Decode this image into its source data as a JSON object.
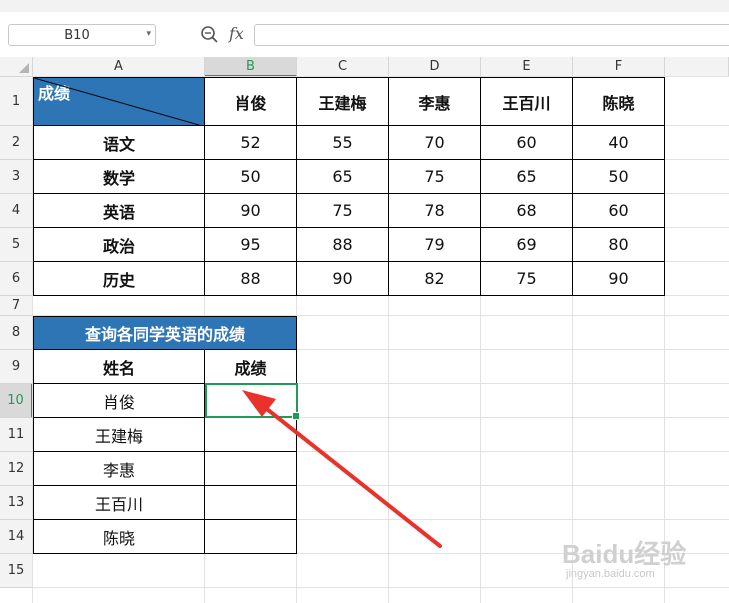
{
  "name_box": "B10",
  "formula": "",
  "columns": [
    "A",
    "B",
    "C",
    "D",
    "E",
    "F"
  ],
  "rows": [
    "1",
    "2",
    "3",
    "4",
    "5",
    "6",
    "7",
    "8",
    "9",
    "10",
    "11",
    "12",
    "13",
    "14",
    "15"
  ],
  "selected_column": "B",
  "selected_row": "10",
  "main_table": {
    "corner_label": "成绩",
    "names": [
      "肖俊",
      "王建梅",
      "李惠",
      "王百川",
      "陈晓"
    ],
    "subjects": [
      {
        "name": "语文",
        "scores": [
          "52",
          "55",
          "70",
          "60",
          "40"
        ]
      },
      {
        "name": "数学",
        "scores": [
          "50",
          "65",
          "75",
          "65",
          "50"
        ]
      },
      {
        "name": "英语",
        "scores": [
          "90",
          "75",
          "78",
          "68",
          "60"
        ]
      },
      {
        "name": "政治",
        "scores": [
          "95",
          "88",
          "79",
          "69",
          "80"
        ]
      },
      {
        "name": "历史",
        "scores": [
          "88",
          "90",
          "82",
          "75",
          "90"
        ]
      }
    ]
  },
  "lookup_table": {
    "title": "查询各同学英语的成绩",
    "col_name": "姓名",
    "col_score": "成绩",
    "names": [
      "肖俊",
      "王建梅",
      "李惠",
      "王百川",
      "陈晓"
    ],
    "scores": [
      "",
      "",
      "",
      "",
      ""
    ]
  },
  "watermark": {
    "text": "Baidu经验",
    "sub": "jingyan.baidu.com"
  },
  "colors": {
    "header_blue": "#2e75b6",
    "selection_green": "#1e9a5b",
    "arrow_red": "#e8322b"
  }
}
